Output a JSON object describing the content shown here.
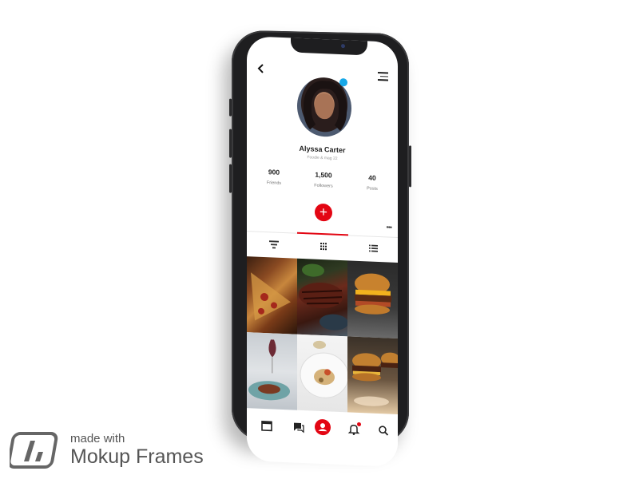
{
  "profile": {
    "name": "Alyssa Carter",
    "handle": "Foodie & mag 22"
  },
  "stats": [
    {
      "value": "900",
      "label": "Friends"
    },
    {
      "value": "1,500",
      "label": "Followers"
    },
    {
      "value": "40",
      "label": "Posts"
    }
  ],
  "actions": {
    "add_label": "+",
    "more_label": "•••"
  },
  "tabs": [
    {
      "name": "filter",
      "icon": "filter-icon",
      "active": false
    },
    {
      "name": "grid",
      "icon": "grid-icon",
      "active": true
    },
    {
      "name": "list",
      "icon": "list-icon",
      "active": false
    }
  ],
  "grid_photos": [
    {
      "subject": "pizza"
    },
    {
      "subject": "steak"
    },
    {
      "subject": "burger"
    },
    {
      "subject": "plated dish with wine"
    },
    {
      "subject": "soup bowl"
    },
    {
      "subject": "burgers"
    }
  ],
  "bottom_nav": [
    {
      "icon": "calendar-icon",
      "active": false
    },
    {
      "icon": "chat-icon",
      "active": false
    },
    {
      "icon": "profile-icon",
      "active": true
    },
    {
      "icon": "bell-icon",
      "active": false,
      "badge": true
    },
    {
      "icon": "search-icon",
      "active": false
    }
  ],
  "colors": {
    "accent": "#e30613",
    "online": "#18a8e8",
    "frame": "#1e1e20"
  },
  "watermark": {
    "line1": "made with",
    "line2": "Mokup Frames"
  }
}
